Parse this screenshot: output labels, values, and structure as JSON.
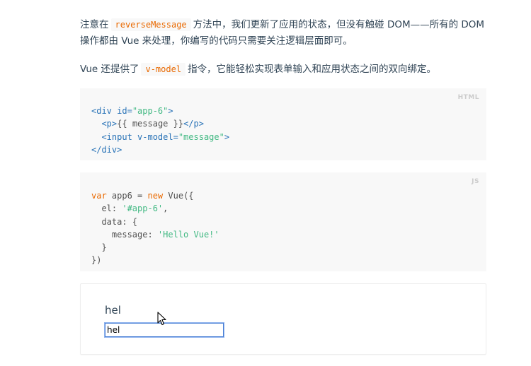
{
  "paragraph1": {
    "before": "注意在",
    "code": "reverseMessage",
    "after": "方法中，我们更新了应用的状态，但没有触碰 DOM——所有的 DOM 操作都由 Vue 来处理，你编写的代码只需要关注逻辑层面即可。"
  },
  "paragraph2": {
    "before": "Vue 还提供了",
    "code": "v-model",
    "after": "指令，它能轻松实现表单输入和应用状态之间的双向绑定。"
  },
  "html_block": {
    "lang": "HTML",
    "line1": {
      "open": "<div ",
      "attr": "id=",
      "val": "\"app-6\"",
      "close": ">"
    },
    "line2": {
      "indent": "  ",
      "open": "<p>",
      "text": "{{ message }}",
      "close": "</p>"
    },
    "line3": {
      "indent": "  ",
      "open": "<input ",
      "attr": "v-model=",
      "val": "\"message\"",
      "close": ">"
    },
    "line4": {
      "close": "</div>"
    }
  },
  "js_block": {
    "lang": "JS",
    "line1": {
      "kw1": "var",
      "text1": " app6 = ",
      "kw2": "new",
      "text2": " Vue({"
    },
    "line2": {
      "text": "  el: ",
      "str": "'#app-6'",
      "end": ","
    },
    "line3": {
      "text": "  data: {"
    },
    "line4": {
      "text": "    message: ",
      "str": "'Hello Vue!'"
    },
    "line5": {
      "text": "  }"
    },
    "line6": {
      "text": "})"
    }
  },
  "demo": {
    "message": "hel",
    "input_value": "hel"
  },
  "colors": {
    "accent_orange": "#e96900",
    "string_green": "#42b983",
    "tag_blue": "#2973b7",
    "text": "#304455"
  }
}
